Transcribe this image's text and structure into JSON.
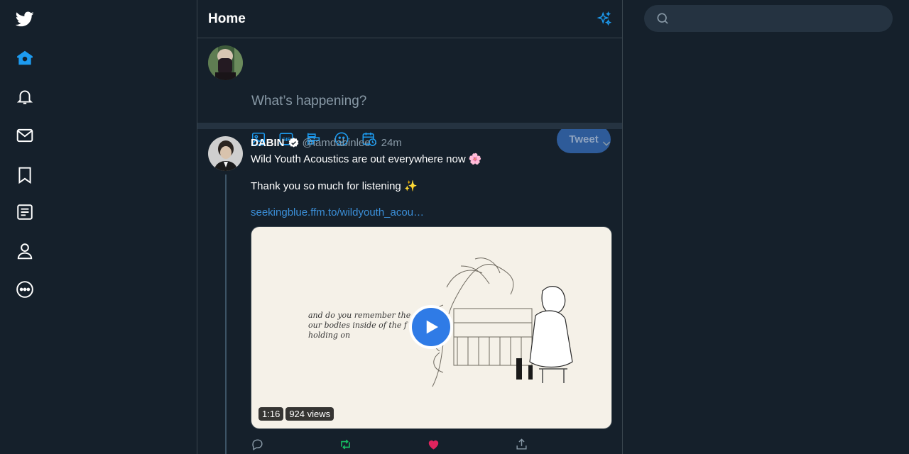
{
  "nav": {
    "items": [
      "twitter-logo",
      "home",
      "notifications",
      "messages",
      "bookmarks",
      "lists",
      "profile",
      "more"
    ]
  },
  "header": {
    "title": "Home"
  },
  "compose": {
    "placeholder": "What’s happening?",
    "tweet_button": "Tweet",
    "tools": [
      "image-icon",
      "gif-icon",
      "poll-icon",
      "emoji-icon",
      "schedule-icon"
    ]
  },
  "tweet": {
    "author": "DABIN",
    "handle": "@iamdabinlee",
    "separator": "·",
    "time": "24m",
    "line1": "Wild Youth Acoustics are out everywhere now 🌸",
    "line2": "Thank you so much for listening ✨",
    "link": "seekingblue.ffm.to/wildyouth_acou…",
    "media": {
      "lyrics": [
        "and do you remember the",
        "our bodies inside of the f",
        "holding on"
      ],
      "duration": "1:16",
      "views": "924 views"
    }
  },
  "search": {
    "placeholder": ""
  },
  "colors": {
    "background": "#15202b",
    "accent": "#1d9bf0",
    "border": "#38444d",
    "retweet": "#17bf63",
    "like": "#e0245e"
  }
}
